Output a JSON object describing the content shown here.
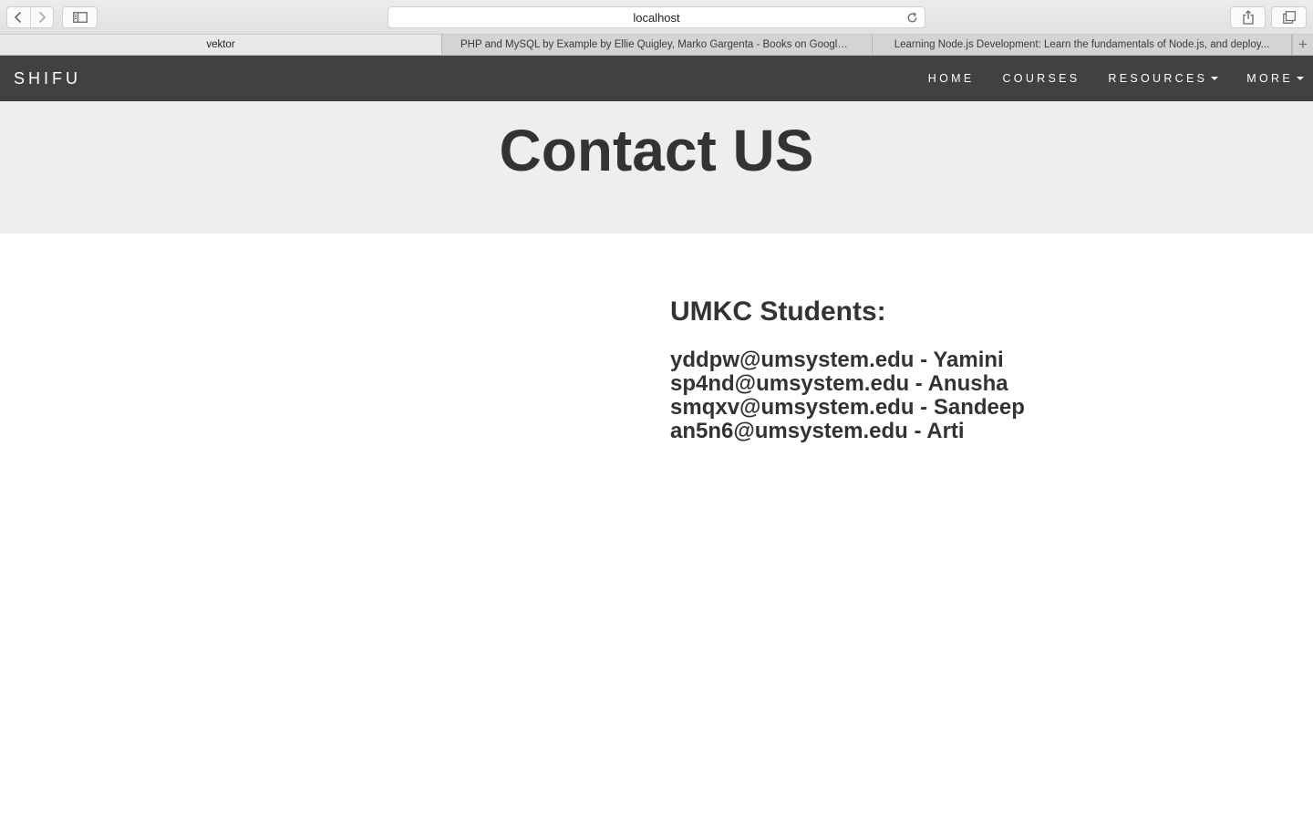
{
  "browser": {
    "address": "localhost",
    "icons": {
      "back": "back-chevron-icon",
      "forward": "forward-chevron-icon",
      "sidebar": "sidebar-icon",
      "reload": "reload-icon",
      "share": "share-icon",
      "tabs": "tabs-overview-icon",
      "new_tab": "plus-icon"
    },
    "tabs": [
      {
        "label": "vektor",
        "active": true
      },
      {
        "label": "PHP and MySQL by Example by Ellie Quigley, Marko Gargenta - Books on Google P...",
        "active": false
      },
      {
        "label": "Learning Node.js Development: Learn the fundamentals of Node.js, and deploy...",
        "active": false
      }
    ],
    "new_tab_label": "+"
  },
  "site": {
    "brand": "SHIFU",
    "nav": {
      "home": "HOME",
      "courses": "COURSES",
      "resources": "RESOURCES",
      "more": "MORE"
    },
    "colors": {
      "navbar": "#414143",
      "hero": "#eeeeee",
      "text": "#333333"
    }
  },
  "hero": {
    "title": "Contact US"
  },
  "contact": {
    "heading": "UMKC Students:",
    "lines": [
      "yddpw@umsystem.edu - Yamini",
      "sp4nd@umsystem.edu - Anusha",
      "smqxv@umsystem.edu - Sandeep",
      "an5n6@umsystem.edu - Arti"
    ]
  }
}
